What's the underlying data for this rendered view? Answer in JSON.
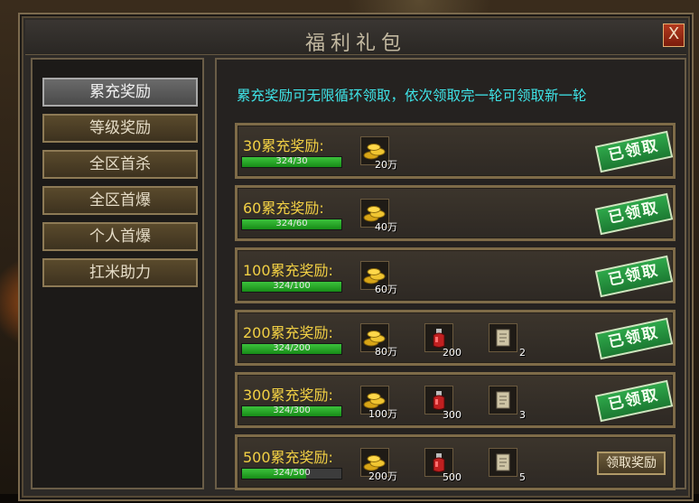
{
  "window": {
    "title": "福利礼包",
    "close_label": "X"
  },
  "menu": {
    "items": [
      {
        "label": "累充奖励",
        "active": true
      },
      {
        "label": "等级奖励",
        "active": false
      },
      {
        "label": "全区首杀",
        "active": false
      },
      {
        "label": "全区首爆",
        "active": false
      },
      {
        "label": "个人首爆",
        "active": false
      },
      {
        "label": "扛米助力",
        "active": false
      }
    ]
  },
  "content": {
    "notice": "累充奖励可无限循环领取，依次领取完一轮可领取新一轮",
    "rows": [
      {
        "label": "30累充奖励:",
        "progress_text": "324/30",
        "progress": 1.0,
        "rewards": [
          {
            "icon": "gold-icon",
            "qty": "20万"
          }
        ],
        "status": "已领取"
      },
      {
        "label": "60累充奖励:",
        "progress_text": "324/60",
        "progress": 1.0,
        "rewards": [
          {
            "icon": "gold-icon",
            "qty": "40万"
          }
        ],
        "status": "已领取"
      },
      {
        "label": "100累充奖励:",
        "progress_text": "324/100",
        "progress": 1.0,
        "rewards": [
          {
            "icon": "gold-icon",
            "qty": "60万"
          }
        ],
        "status": "已领取"
      },
      {
        "label": "200累充奖励:",
        "progress_text": "324/200",
        "progress": 1.0,
        "rewards": [
          {
            "icon": "gold-icon",
            "qty": "80万"
          },
          {
            "icon": "potion-icon",
            "qty": "200"
          },
          {
            "icon": "scroll-icon",
            "qty": "2"
          }
        ],
        "status": "已领取"
      },
      {
        "label": "300累充奖励:",
        "progress_text": "324/300",
        "progress": 1.0,
        "rewards": [
          {
            "icon": "gold-icon",
            "qty": "100万"
          },
          {
            "icon": "potion-icon",
            "qty": "300"
          },
          {
            "icon": "scroll-icon",
            "qty": "3"
          }
        ],
        "status": "已领取"
      },
      {
        "label": "500累充奖励:",
        "progress_text": "324/500",
        "progress": 0.648,
        "rewards": [
          {
            "icon": "gold-icon",
            "qty": "200万"
          },
          {
            "icon": "potion-icon",
            "qty": "500"
          },
          {
            "icon": "scroll-icon",
            "qty": "5"
          }
        ],
        "status": "",
        "claim_label": "领取奖励"
      }
    ]
  },
  "colors": {
    "notice": "#3fe4e8",
    "row_label": "#f2d044",
    "progress": "#2aa82a",
    "stamp": "#2ea84a"
  }
}
